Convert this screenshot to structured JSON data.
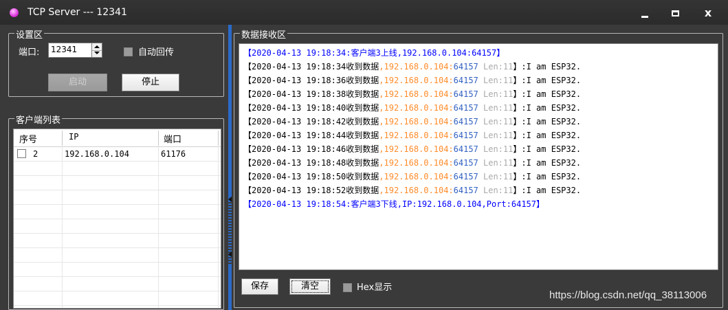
{
  "window": {
    "title": "TCP Server --- 12341",
    "min_icon": "minimize-icon",
    "max_icon": "maximize-icon",
    "close_glyph": "x"
  },
  "settings": {
    "group_title": "设置区",
    "port_label": "端口:",
    "port_value": "12341",
    "auto_echo_label": "自动回传",
    "auto_echo_checked": false,
    "start_label": "启动",
    "start_enabled": false,
    "stop_label": "停止"
  },
  "clients": {
    "group_title": "客户端列表",
    "columns": [
      "序号",
      "IP",
      "端口"
    ],
    "rows": [
      {
        "checked": false,
        "index": "2",
        "ip": "192.168.0.104",
        "port": "61176"
      }
    ]
  },
  "receive": {
    "group_title": "数据接收区",
    "lines": [
      {
        "type": "event",
        "text": "【2020-04-13 19:18:34:客户端3上线,192.168.0.104:64157】"
      },
      {
        "type": "data",
        "time": "【2020-04-13 19:18:34收到数据",
        "ip": ",192.168.0.104:",
        "port": "64157",
        "len": " Len:11",
        "close": "】",
        "payload": ":I am ESP32."
      },
      {
        "type": "data",
        "time": "【2020-04-13 19:18:36收到数据",
        "ip": ",192.168.0.104:",
        "port": "64157",
        "len": " Len:11",
        "close": "】",
        "payload": ":I am ESP32."
      },
      {
        "type": "data",
        "time": "【2020-04-13 19:18:38收到数据",
        "ip": ",192.168.0.104:",
        "port": "64157",
        "len": " Len:11",
        "close": "】",
        "payload": ":I am ESP32."
      },
      {
        "type": "data",
        "time": "【2020-04-13 19:18:40收到数据",
        "ip": ",192.168.0.104:",
        "port": "64157",
        "len": " Len:11",
        "close": "】",
        "payload": ":I am ESP32."
      },
      {
        "type": "data",
        "time": "【2020-04-13 19:18:42收到数据",
        "ip": ",192.168.0.104:",
        "port": "64157",
        "len": " Len:11",
        "close": "】",
        "payload": ":I am ESP32."
      },
      {
        "type": "data",
        "time": "【2020-04-13 19:18:44收到数据",
        "ip": ",192.168.0.104:",
        "port": "64157",
        "len": " Len:11",
        "close": "】",
        "payload": ":I am ESP32."
      },
      {
        "type": "data",
        "time": "【2020-04-13 19:18:46收到数据",
        "ip": ",192.168.0.104:",
        "port": "64157",
        "len": " Len:11",
        "close": "】",
        "payload": ":I am ESP32."
      },
      {
        "type": "data",
        "time": "【2020-04-13 19:18:48收到数据",
        "ip": ",192.168.0.104:",
        "port": "64157",
        "len": " Len:11",
        "close": "】",
        "payload": ":I am ESP32."
      },
      {
        "type": "data",
        "time": "【2020-04-13 19:18:50收到数据",
        "ip": ",192.168.0.104:",
        "port": "64157",
        "len": " Len:11",
        "close": "】",
        "payload": ":I am ESP32."
      },
      {
        "type": "data",
        "time": "【2020-04-13 19:18:52收到数据",
        "ip": ",192.168.0.104:",
        "port": "64157",
        "len": " Len:11",
        "close": "】",
        "payload": ":I am ESP32."
      },
      {
        "type": "event",
        "text": "【2020-04-13 19:18:54:客户端3下线,IP:192.168.0.104,Port:64157】"
      }
    ],
    "save_label": "保存",
    "clear_label": "清空",
    "hex_label": "Hex显示",
    "hex_checked": false
  },
  "watermark": "https://blog.csdn.net/qq_38113006",
  "colors": {
    "event": "#0000ff",
    "ip": "#ff8c2a",
    "port": "#3060c0",
    "len": "#aaaaaa",
    "splitter": "#2a6ac8"
  }
}
